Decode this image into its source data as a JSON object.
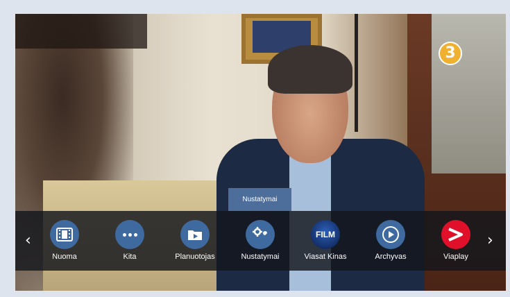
{
  "channel_logo": "3",
  "tooltip": "Nustatymai",
  "nav": {
    "prev_arrow": "‹",
    "next_arrow": "›"
  },
  "menu_items": [
    {
      "label": "Nuoma",
      "icon": "film-strip-icon"
    },
    {
      "label": "Kita",
      "icon": "more-dots-icon"
    },
    {
      "label": "Planuotojas",
      "icon": "folder-play-icon"
    },
    {
      "label": "Nustatymai",
      "icon": "settings-tools-icon"
    },
    {
      "label": "Viasat Kinas",
      "icon": "film-logo-icon",
      "logo_text": "FILM"
    },
    {
      "label": "Archyvas",
      "icon": "play-circle-icon"
    },
    {
      "label": "Viaplay",
      "icon": "viaplay-logo-icon"
    }
  ],
  "colors": {
    "accent": "#3f6aa0",
    "tooltip_bg": "#4d6e9b",
    "viaplay": "#e0102a"
  }
}
